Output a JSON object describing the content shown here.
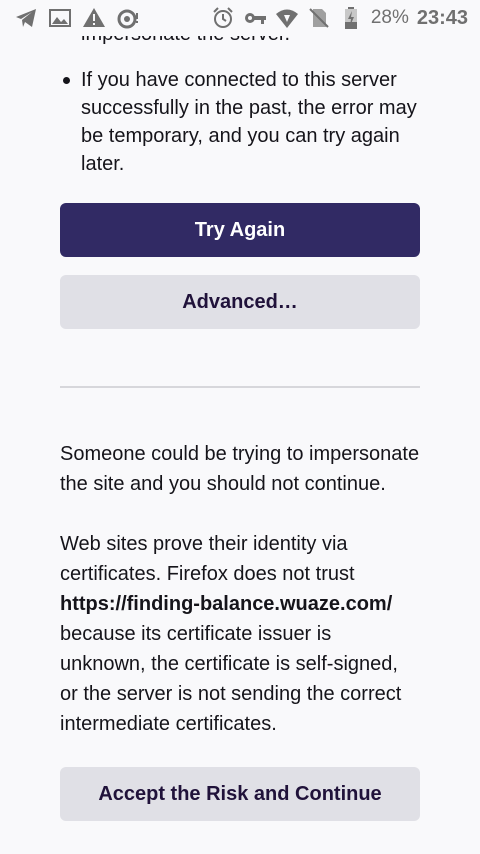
{
  "status_bar": {
    "battery_percent": "28%",
    "time": "23:43",
    "left_icons": [
      "telegram-icon",
      "image-icon",
      "warning-icon",
      "camera-icon"
    ],
    "right_icons": [
      "alarm-icon",
      "vpn-key-icon",
      "wifi-icon",
      "no-sim-icon",
      "battery-icon"
    ]
  },
  "error_page": {
    "cut_off_text": "impersonate the server.",
    "bullet_text": "If you have connected to this server successfully in the past, the error may be temporary, and you can try again later.",
    "try_again_label": "Try Again",
    "advanced_label": "Advanced…",
    "warning_text": "Someone could be trying to impersonate the site and you should not continue.",
    "details_before": "Web sites prove their identity via certificates. Firefox does not trust ",
    "details_url": "https://finding-balance.wuaze.com/",
    "details_after": " because its certificate issuer is unknown, the certificate is self-signed, or the server is not sending the correct intermediate certificates.",
    "accept_label": "Accept the Risk and Continue"
  }
}
